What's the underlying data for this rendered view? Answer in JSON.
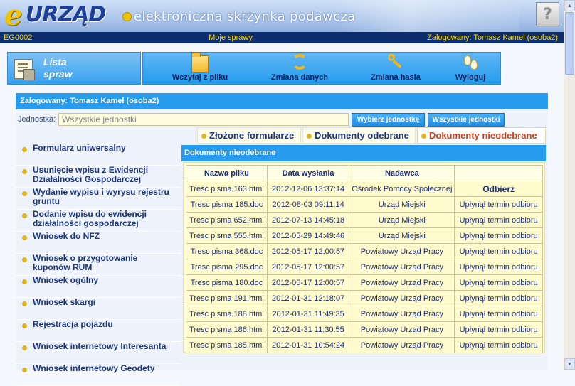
{
  "header": {
    "logo_e": "e",
    "logo_main": "URZĄD",
    "logo_tagline": "elektroniczna skrzynka podawcza",
    "help_label": "?"
  },
  "statusbar": {
    "code": "EG0002",
    "section": "Moje sprawy",
    "logged": "Zalogowany: Tomasz Kamel (osoba2)"
  },
  "toolbar": {
    "title_line1": "Lista",
    "title_line2": "spraw",
    "buttons": [
      {
        "label": "Wczytaj z pliku",
        "icon": "folder-icon"
      },
      {
        "label": "Zmiana danych",
        "icon": "refresh-icon"
      },
      {
        "label": "Zmiana hasła",
        "icon": "key-icon"
      },
      {
        "label": "Wyloguj",
        "icon": "footsteps-icon"
      }
    ]
  },
  "panel": {
    "header": "Zalogowany: Tomasz Kamel (osoba2)",
    "unit_label": "Jednostka:",
    "unit_value": "Wszystkie jednostki",
    "btn_choose": "Wybierz jednostkę",
    "btn_all": "Wszystkie jednostki"
  },
  "tabs": [
    {
      "label": "Złożone formularze",
      "active": false
    },
    {
      "label": "Dokumenty odebrane",
      "active": false
    },
    {
      "label": "Dokumenty nieodebrane",
      "active": true
    }
  ],
  "menu": [
    "Formularz uniwersalny",
    "Usunięcie wpisu z Ewidencji Działalności Gospodarczej",
    "Wydanie wypisu i wyrysu rejestru gruntu",
    "Dodanie wpisu do ewidencji działalności gospodarczej",
    "Wniosek do NFZ",
    "Wniosek o przygotowanie kuponów RUM",
    "Wniosek ogólny",
    "Wniosek skargi",
    "Rejestracja pojazdu",
    "Wniosek internetowy Interesanta",
    "Wniosek internetowy Geodety"
  ],
  "docs": {
    "title": "Dokumenty nieodebrane",
    "columns": [
      "Nazwa pliku",
      "Data wysłania",
      "Nadawca",
      ""
    ],
    "rows": [
      [
        "Tresc pisma 163.html",
        "2012-12-06 13:37:14",
        "Ośrodek Pomocy Społecznej",
        "Odbierz"
      ],
      [
        "Tresc pisma 185.doc",
        "2012-08-03 09:11:14",
        "Urząd Miejski",
        "Upłynął termin odbioru"
      ],
      [
        "Tresc pisma 652.html",
        "2012-07-13 14:45:18",
        "Urząd Miejski",
        "Upłynął termin odbioru"
      ],
      [
        "Tresc pisma 555.html",
        "2012-05-29 14:49:46",
        "Urząd Miejski",
        "Upłynął termin odbioru"
      ],
      [
        "Tresc pisma 368.doc",
        "2012-05-17 12:00:57",
        "Powiatowy Urząd Pracy",
        "Upłynął termin odbioru"
      ],
      [
        "Tresc pisma 295.doc",
        "2012-05-17 12:00:57",
        "Powiatowy Urząd Pracy",
        "Upłynął termin odbioru"
      ],
      [
        "Tresc pisma 180.doc",
        "2012-05-17 12:00:57",
        "Powiatowy Urząd Pracy",
        "Upłynął termin odbioru"
      ],
      [
        "Tresc pisma 191.html",
        "2012-01-31 12:18:07",
        "Powiatowy Urząd Pracy",
        "Upłynął termin odbioru"
      ],
      [
        "Tresc pisma 188.html",
        "2012-01-31 11:49:35",
        "Powiatowy Urząd Pracy",
        "Upłynął termin odbioru"
      ],
      [
        "Tresc pisma 186.html",
        "2012-01-31 11:30:55",
        "Powiatowy Urząd Pracy",
        "Upłynął termin odbioru"
      ],
      [
        "Tresc pisma 185.html",
        "2012-01-31 10:54:24",
        "Powiatowy Urząd Pracy",
        "Upłynął termin odbioru"
      ]
    ]
  }
}
